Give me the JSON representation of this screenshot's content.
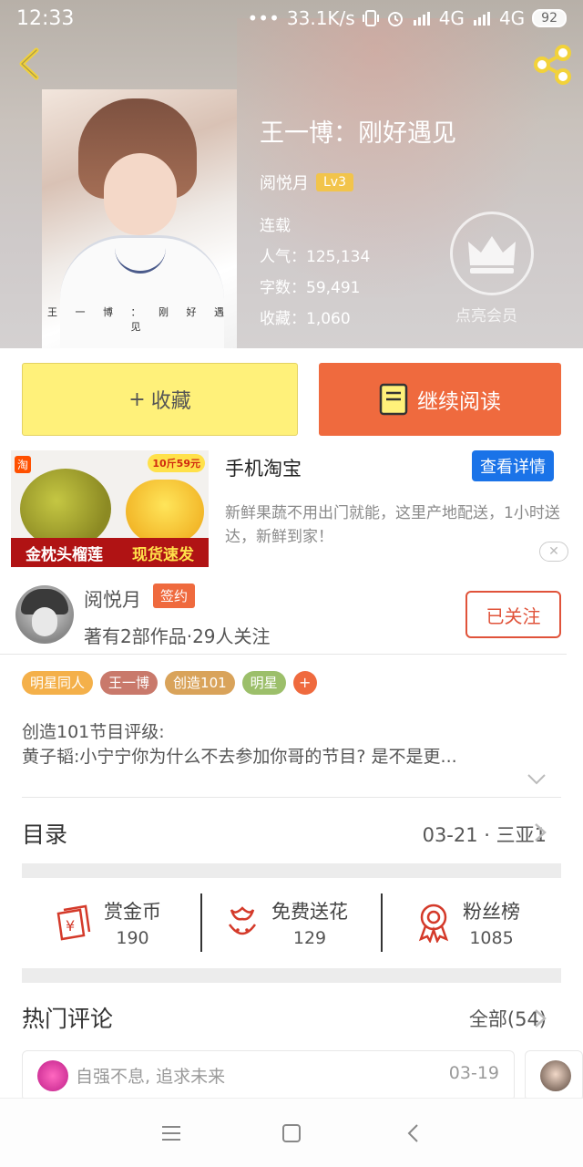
{
  "status_bar": {
    "time": "12:33",
    "dots": "•••",
    "network_speed": "33.1K/s",
    "signal_1": "4G",
    "signal_2": "4G",
    "battery": "92"
  },
  "book": {
    "title": "王一博：刚好遇见",
    "author": "阅悦月",
    "level": "Lv3",
    "status": "连载",
    "popularity": "人气：125,134",
    "word_count": "字数：59,491",
    "favorites": "收藏：1,060",
    "cover_caption": "王 一 博 ： 刚 好 遇 见"
  },
  "vip": {
    "label": "点亮会员"
  },
  "actions": {
    "favorite": "收藏",
    "continue_reading": "继续阅读"
  },
  "ad": {
    "badge": "淘",
    "price_tag": "10斤59元",
    "banner_left": "金枕头榴莲",
    "banner_right": "现货速发",
    "title": "手机淘宝",
    "detail_button": "查看详情",
    "description": "新鲜果蔬不用出门就能，这里产地配送，1小时送达，新鲜到家！",
    "close": "✕"
  },
  "writer": {
    "name": "阅悦月",
    "badge": "签约",
    "stats": "著有2部作品·29人关注",
    "follow_button": "已关注"
  },
  "tags": [
    {
      "label": "明星同人",
      "color": "#f4b04a"
    },
    {
      "label": "王一博",
      "color": "#c9796b"
    },
    {
      "label": "创造101",
      "color": "#d9a35a"
    },
    {
      "label": "明星",
      "color": "#9cbf6a"
    },
    {
      "label": "+",
      "color": "#ef6a3e"
    }
  ],
  "description": {
    "line1": "创造101节目评级:",
    "line2": "黄子韬:小宁宁你为什么不去参加你哥的节目? 是不是更..."
  },
  "toc": {
    "title": "目录",
    "latest": "03-21 · 三亚1"
  },
  "stats": [
    {
      "label": "赏金币",
      "value": "190",
      "icon": "reward-coin-icon"
    },
    {
      "label": "免费送花",
      "value": "129",
      "icon": "flower-icon"
    },
    {
      "label": "粉丝榜",
      "value": "1085",
      "icon": "medal-icon"
    }
  ],
  "hot_comments": {
    "title": "热门评论",
    "all": "全部(54)",
    "items": [
      {
        "text": "自强不息, 追求未来",
        "date": "03-19"
      }
    ]
  },
  "colors": {
    "accent": "#ef6a3e",
    "favorite_button": "#fff17a",
    "ad_button": "#1a73e8"
  }
}
